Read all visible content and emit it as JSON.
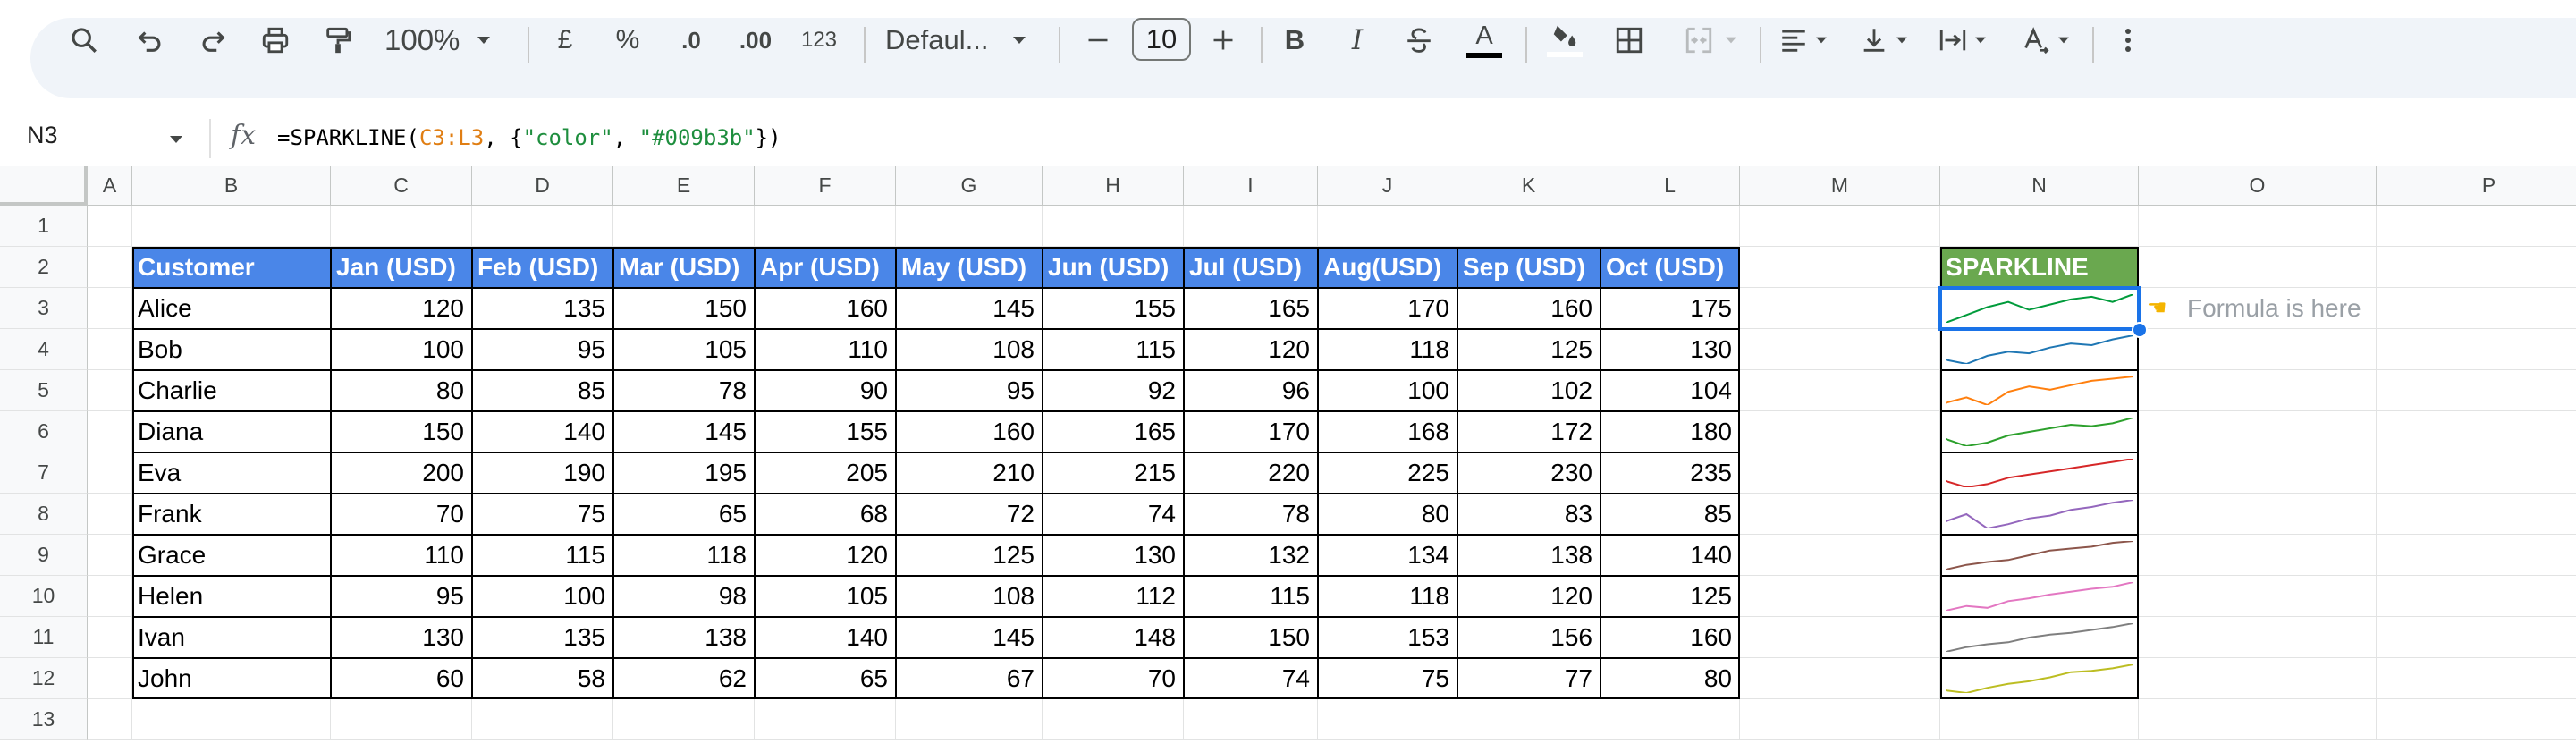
{
  "toolbar": {
    "zoom": "100%",
    "currency": "£",
    "percent": "%",
    "decrease_decimal": ".0",
    "increase_decimal": ".00",
    "number_format": "123",
    "font": "Defaul...",
    "font_size": "10"
  },
  "formula_bar": {
    "cell_ref": "N3",
    "formula_prefix": "=SPARKLINE(",
    "formula_ref": "C3:L3",
    "formula_mid": ", {",
    "formula_key": "\"color\"",
    "formula_comma": ", ",
    "formula_value": "\"#009b3b\"",
    "formula_suffix": "})"
  },
  "columns": [
    "A",
    "B",
    "C",
    "D",
    "E",
    "F",
    "G",
    "H",
    "I",
    "J",
    "K",
    "L",
    "M",
    "N",
    "O",
    "P"
  ],
  "rows": [
    "1",
    "2",
    "3",
    "4",
    "5",
    "6",
    "7",
    "8",
    "9",
    "10",
    "11",
    "12",
    "13"
  ],
  "table": {
    "headers": [
      "Customer",
      "Jan (USD)",
      "Feb (USD)",
      "Mar (USD)",
      "Apr (USD)",
      "May (USD)",
      "Jun (USD)",
      "Jul (USD)",
      "Aug(USD)",
      "Sep (USD)",
      "Oct (USD)"
    ],
    "header_color": "#4a86e8",
    "rows": [
      {
        "name": "Alice",
        "values": [
          "120",
          "135",
          "150",
          "160",
          "145",
          "155",
          "165",
          "170",
          "160",
          "175"
        ]
      },
      {
        "name": "Bob",
        "values": [
          "100",
          "95",
          "105",
          "110",
          "108",
          "115",
          "120",
          "118",
          "125",
          "130"
        ]
      },
      {
        "name": "Charlie",
        "values": [
          "80",
          "85",
          "78",
          "90",
          "95",
          "92",
          "96",
          "100",
          "102",
          "104"
        ]
      },
      {
        "name": "Diana",
        "values": [
          "150",
          "140",
          "145",
          "155",
          "160",
          "165",
          "170",
          "168",
          "172",
          "180"
        ]
      },
      {
        "name": "Eva",
        "values": [
          "200",
          "190",
          "195",
          "205",
          "210",
          "215",
          "220",
          "225",
          "230",
          "235"
        ]
      },
      {
        "name": "Frank",
        "values": [
          "70",
          "75",
          "65",
          "68",
          "72",
          "74",
          "78",
          "80",
          "83",
          "85"
        ]
      },
      {
        "name": "Grace",
        "values": [
          "110",
          "115",
          "118",
          "120",
          "125",
          "130",
          "132",
          "134",
          "138",
          "140"
        ]
      },
      {
        "name": "Helen",
        "values": [
          "95",
          "100",
          "98",
          "105",
          "108",
          "112",
          "115",
          "118",
          "120",
          "125"
        ]
      },
      {
        "name": "Ivan",
        "values": [
          "130",
          "135",
          "138",
          "140",
          "145",
          "148",
          "150",
          "153",
          "156",
          "160"
        ]
      },
      {
        "name": "John",
        "values": [
          "60",
          "58",
          "62",
          "65",
          "67",
          "70",
          "74",
          "75",
          "77",
          "80"
        ]
      }
    ]
  },
  "sparkline": {
    "header": "SPARKLINE",
    "header_color": "#6aa84f",
    "colors": [
      "#009b3b",
      "#1f77b4",
      "#ff7f0e",
      "#2ca02c",
      "#d62728",
      "#9467bd",
      "#8c564b",
      "#e377c2",
      "#7f7f7f",
      "#bcbd22"
    ]
  },
  "note": {
    "icon": "pointing-hand-icon",
    "text": "Formula is here"
  }
}
